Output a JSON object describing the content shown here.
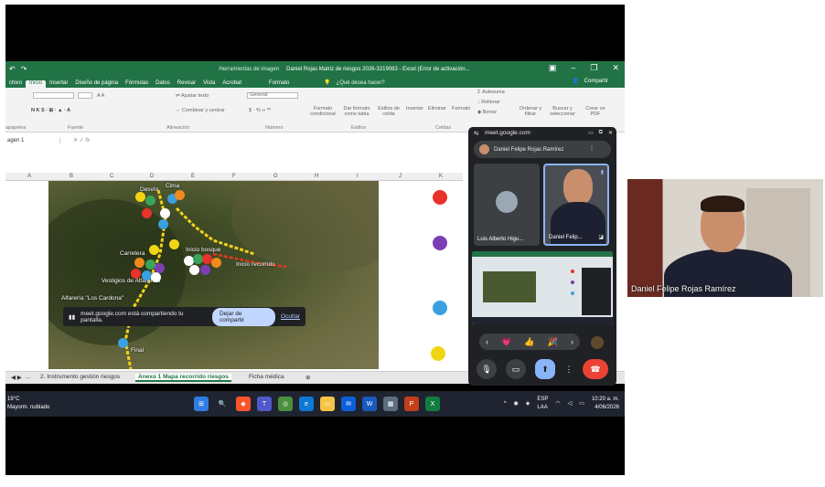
{
  "excel": {
    "quick_access": [
      "↶",
      "↷"
    ],
    "contextual_tab": "Herramientas de imagen",
    "document_title": "Daniel Rojas Matriz de riesgos  2026-3219083 - Excel (Error de activación...",
    "menu": [
      "chivo",
      "Inicio",
      "Insertar",
      "Diseño de página",
      "Fórmulas",
      "Datos",
      "Revisar",
      "Vista",
      "Acrobat",
      "Formato"
    ],
    "tell_me": "¿Qué desea hacer?",
    "share": "Compartir",
    "ribbon": {
      "wrap_text": "Ajustar texto",
      "merge_center": "Combinar y centrar",
      "number_format": "General",
      "conditional_format": "Formato condicional",
      "format_table": "Dar formato como tabla",
      "cell_styles": "Estilos de celda",
      "insert": "Insertar",
      "delete": "Eliminar",
      "format": "Formato",
      "autosum": "Autosuma",
      "fill": "Rellenar",
      "clear": "Borrar",
      "sort_filter": "Ordenar y filtrar",
      "find_select": "Buscar y seleccionar",
      "create_pdf": "Crear un PDF",
      "groups": [
        "apapeles",
        "Fuente",
        "Alineación",
        "Número",
        "Estilos",
        "Celdas"
      ]
    },
    "name_box": "agen 1",
    "columns": [
      "A",
      "B",
      "C",
      "D",
      "E",
      "F",
      "G",
      "H",
      "I",
      "J",
      "K"
    ],
    "map_labels": {
      "desvio": "Desvío",
      "cima": "Cima",
      "carretera": "Carretera",
      "inicio_bosque": "Inicio bosque",
      "inicio_recorrido": "Inicio recorrido",
      "vestigios": "Vestigios de Alfarerías",
      "alfareria": "Alfarería \"Los Cardona\"",
      "final": "Final"
    },
    "share_banner": {
      "text": "meet.google.com está compartiendo tu pantalla.",
      "stop": "Dejar de compartir",
      "hide": "Ocultar"
    },
    "sheet_tabs": [
      "...",
      "2. Instrumento gestión riesgos",
      "Anexo 1 Mapa recorrido riesgos",
      "Ficha médica"
    ],
    "legend_colors": [
      "#e8322a",
      "#7b3fb3",
      "#3aa0e0",
      "#f2d512"
    ]
  },
  "taskbar": {
    "temp": "19°C",
    "weather": "Mayorm. nublado",
    "lang": "ESP",
    "lang2": "LAA",
    "time": "10:20 a. m.",
    "date": "4/06/2026"
  },
  "meet": {
    "url": "meet.google.com",
    "presenter_name": "Daniel Felipe Rojas Ramírez",
    "tile1_name": "Luis Alberto Higu...",
    "tile2_name": "Daniel Felip...",
    "reactions": [
      "‹",
      "💗",
      "👍",
      "🎉",
      "›"
    ]
  },
  "camera": {
    "name": "Daniel Felipe Rojas Ramírez"
  }
}
